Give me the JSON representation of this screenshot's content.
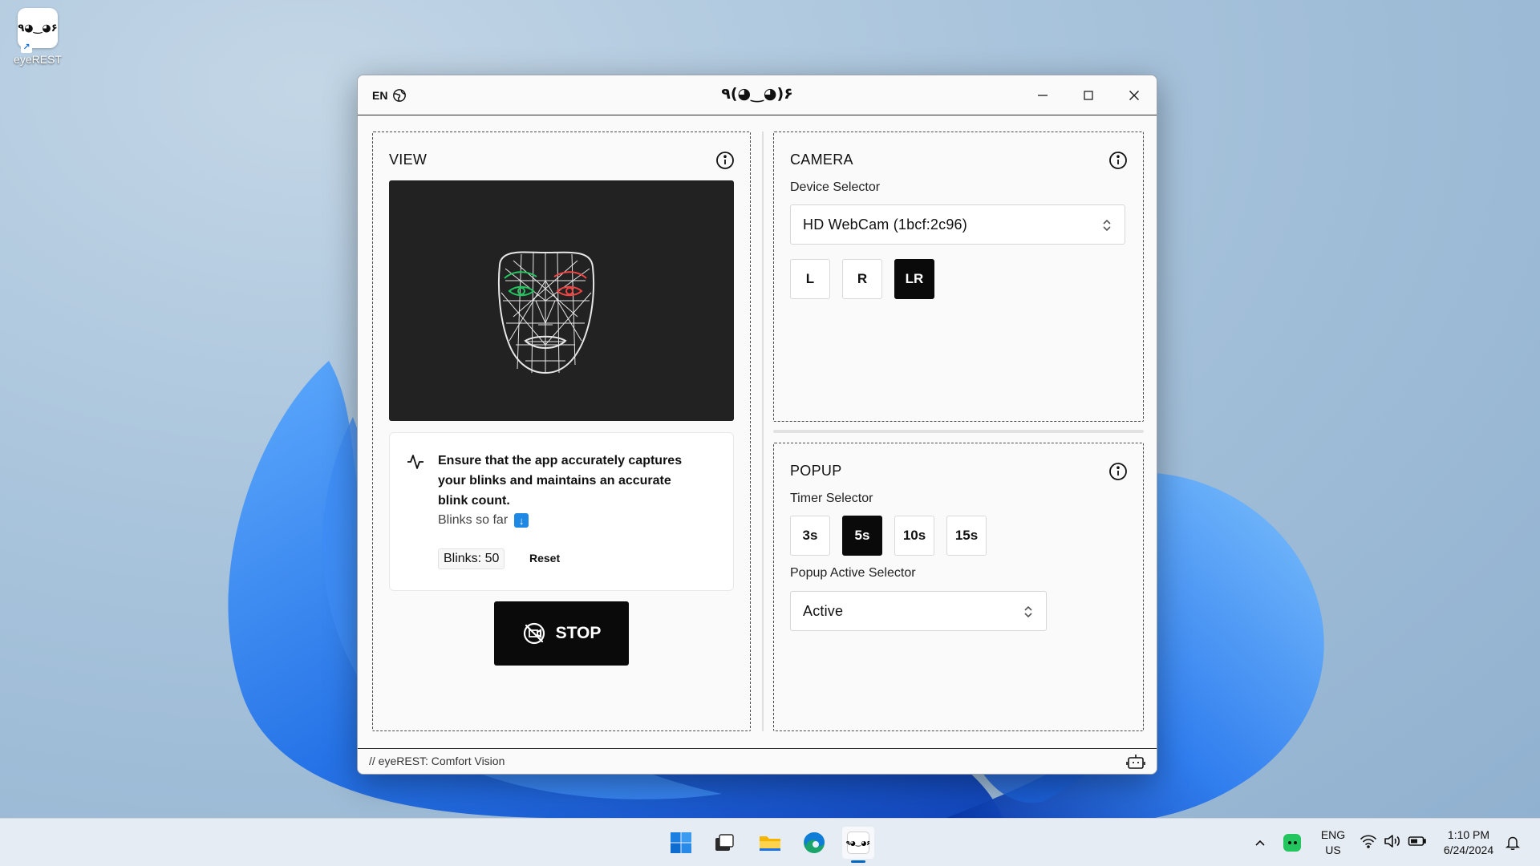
{
  "desktop": {
    "icon_label": "eyeREST",
    "icon_glyph": "٩◕‿◕۶"
  },
  "window": {
    "lang": "EN",
    "title": "٩(◕‿◕)۶",
    "view": {
      "title": "VIEW",
      "hint": "Ensure that the app accurately captures your blinks and maintains an accurate blink count.",
      "blinks_so_far": "Blinks so far",
      "blink_count": "Blinks: 50",
      "reset": "Reset",
      "stop": "STOP"
    },
    "camera": {
      "title": "CAMERA",
      "device_label": "Device Selector",
      "device_value": "HD WebCam (1bcf:2c96)",
      "eye_options": [
        "L",
        "R",
        "LR"
      ],
      "eye_selected": "LR"
    },
    "popup": {
      "title": "POPUP",
      "timer_label": "Timer Selector",
      "timer_options": [
        "3s",
        "5s",
        "10s",
        "15s"
      ],
      "timer_selected": "5s",
      "active_label": "Popup Active Selector",
      "active_value": "Active"
    },
    "status": "// eyeREST: Comfort Vision"
  },
  "taskbar": {
    "lang_line1": "ENG",
    "lang_line2": "US",
    "time": "1:10 PM",
    "date": "6/24/2024"
  },
  "colors": {
    "accent_dark": "#0a0a0a",
    "eye_left": "#22c55e",
    "eye_right": "#ef4444",
    "taskbar_accent": "#0067c0"
  }
}
